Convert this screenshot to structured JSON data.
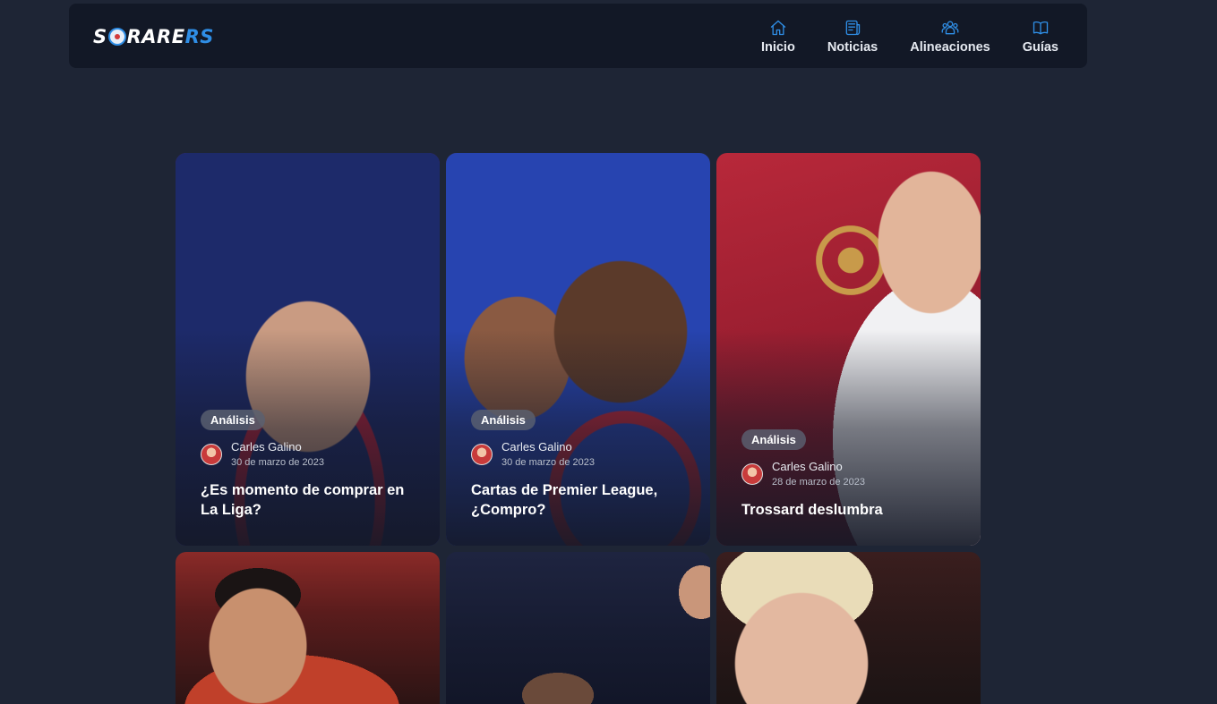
{
  "brand": {
    "logo_left": "S",
    "logo_mid": "RARE",
    "logo_right": "RS"
  },
  "nav": [
    {
      "label": "Inicio",
      "icon": "home-icon"
    },
    {
      "label": "Noticias",
      "icon": "newspaper-icon"
    },
    {
      "label": "Alineaciones",
      "icon": "users-icon"
    },
    {
      "label": "Guías",
      "icon": "book-icon"
    }
  ],
  "colors": {
    "accent": "#2f8ee6",
    "background": "#1e2535",
    "navbar": "#121826"
  },
  "articles": [
    {
      "category": "Análisis",
      "author": "Carles Galino",
      "date": "30 de marzo de 2023",
      "title": "¿Es momento de comprar en La Liga?"
    },
    {
      "category": "Análisis",
      "author": "Carles Galino",
      "date": "30 de marzo de 2023",
      "title": "Cartas de Premier League, ¿Compro?"
    },
    {
      "category": "Análisis",
      "author": "Carles Galino",
      "date": "28 de marzo de 2023",
      "title": "Trossard deslumbra"
    }
  ]
}
